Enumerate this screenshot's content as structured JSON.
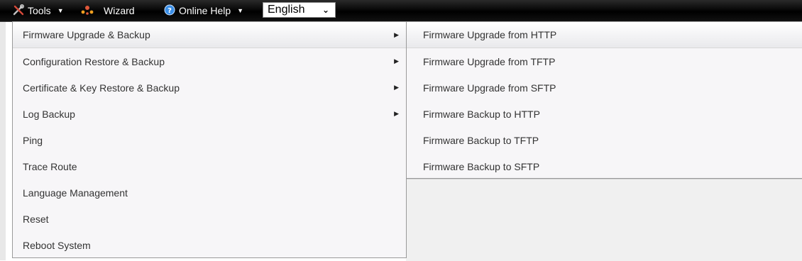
{
  "toolbar": {
    "tools_label": "Tools",
    "wizard_label": "Wizard",
    "help_label": "Online Help",
    "language": {
      "selected": "English"
    }
  },
  "tools_menu": {
    "items": [
      {
        "label": "Firmware Upgrade & Backup",
        "has_submenu": true
      },
      {
        "label": "Configuration Restore & Backup",
        "has_submenu": true
      },
      {
        "label": "Certificate & Key Restore & Backup",
        "has_submenu": true
      },
      {
        "label": "Log Backup",
        "has_submenu": true
      },
      {
        "label": "Ping",
        "has_submenu": false
      },
      {
        "label": "Trace Route",
        "has_submenu": false
      },
      {
        "label": "Language Management",
        "has_submenu": false
      },
      {
        "label": "Reset",
        "has_submenu": false
      },
      {
        "label": "Reboot System",
        "has_submenu": false
      }
    ]
  },
  "firmware_submenu": {
    "items": [
      {
        "label": "Firmware Upgrade from HTTP"
      },
      {
        "label": "Firmware Upgrade from TFTP"
      },
      {
        "label": "Firmware Upgrade from SFTP"
      },
      {
        "label": "Firmware Backup to HTTP"
      },
      {
        "label": "Firmware Backup to TFTP"
      },
      {
        "label": "Firmware Backup to SFTP"
      }
    ]
  },
  "icons": {
    "tools": "tools-icon",
    "wizard": "wizard-icon",
    "help": "help-icon",
    "dropdown": "caret-down-icon",
    "submenu": "chevron-right-icon"
  },
  "colors": {
    "toolbar_bg": "#000000",
    "menu_bg": "#f7f6f8",
    "help_icon": "#3a8ee6",
    "tools_icon": "#d64a3a",
    "wizard_icon": "#e0583a"
  }
}
